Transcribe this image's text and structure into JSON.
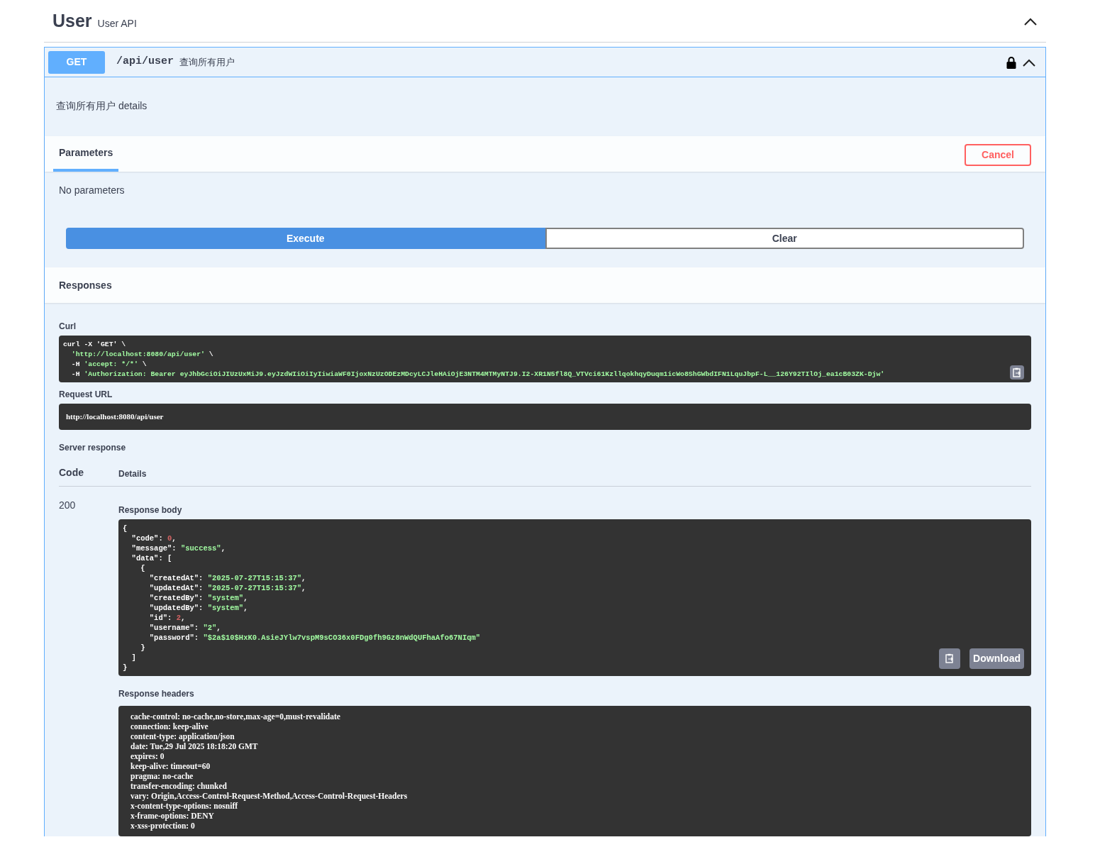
{
  "tag": {
    "name": "User",
    "description": "User API",
    "expanded": true
  },
  "operation": {
    "method": "GET",
    "path": "/api/user",
    "summary": "查询所有用户",
    "locked": true,
    "expanded": true,
    "description": "查询所有用户 details",
    "parameters": {
      "tab": "Parameters",
      "cancel_button": "Cancel",
      "message": "No parameters"
    },
    "buttons": [
      {
        "label": "Execute",
        "kind": "primary"
      },
      {
        "label": "Clear",
        "kind": "secondary"
      }
    ],
    "responses": {
      "title": "Responses",
      "curl": {
        "label": "Curl",
        "lines": [
          "curl -X 'GET' \\",
          "  'http://localhost:8080/api/user' \\",
          "  -H 'accept: */*' \\",
          "  -H 'Authorization: Bearer eyJhbGciOiJIUzUxMiJ9.eyJzdWIiOiIyIiwiaWF0IjoxNzUzODEzMDcyLCJleHAiOjE3NTM4MTMyNTJ9.I2-XR1N5fl8Q_VTVci61KzllqokhqyDuqm1icWo8ShGWbdIFN1LquJbpF-L__126Y92TIlOj_ea1cB03ZK-Djw'"
        ]
      },
      "request_url": {
        "label": "Request URL",
        "value": "http://localhost:8080/api/user"
      },
      "server_response": {
        "label": "Server response",
        "columns": [
          "Code",
          "Details"
        ],
        "code": "200",
        "body": {
          "label": "Response body",
          "download_button": "Download",
          "lines": [
            "{",
            "  \"code\": 0,",
            "  \"message\": \"success\",",
            "  \"data\": [",
            "    {",
            "      \"createdAt\": \"2025-07-27T15:15:37\",",
            "      \"updatedAt\": \"2025-07-27T15:15:37\",",
            "      \"createdBy\": \"system\",",
            "      \"updatedBy\": \"system\",",
            "      \"id\": 2,",
            "      \"username\": \"2\",",
            "      \"password\": \"$2a$10$HxK0.AsieJYlw7vspM9sCO36x0FDg0fh9Gz8nWdQUFhaAfo67NIqm\"",
            "    }",
            "  ]",
            "}"
          ]
        },
        "headers": {
          "label": "Response headers",
          "lines": [
            "cache-control: no-cache,no-store,max-age=0,must-revalidate",
            "connection: keep-alive",
            "content-type: application/json",
            "date: Tue,29 Jul 2025 18:18:20 GMT",
            "expires: 0",
            "keep-alive: timeout=60",
            "pragma: no-cache",
            "transfer-encoding: chunked",
            "vary: Origin,Access-Control-Request-Method,Access-Control-Request-Headers",
            "x-content-type-options: nosniff",
            "x-frame-options: DENY",
            "x-xss-protection: 0"
          ]
        }
      }
    }
  }
}
